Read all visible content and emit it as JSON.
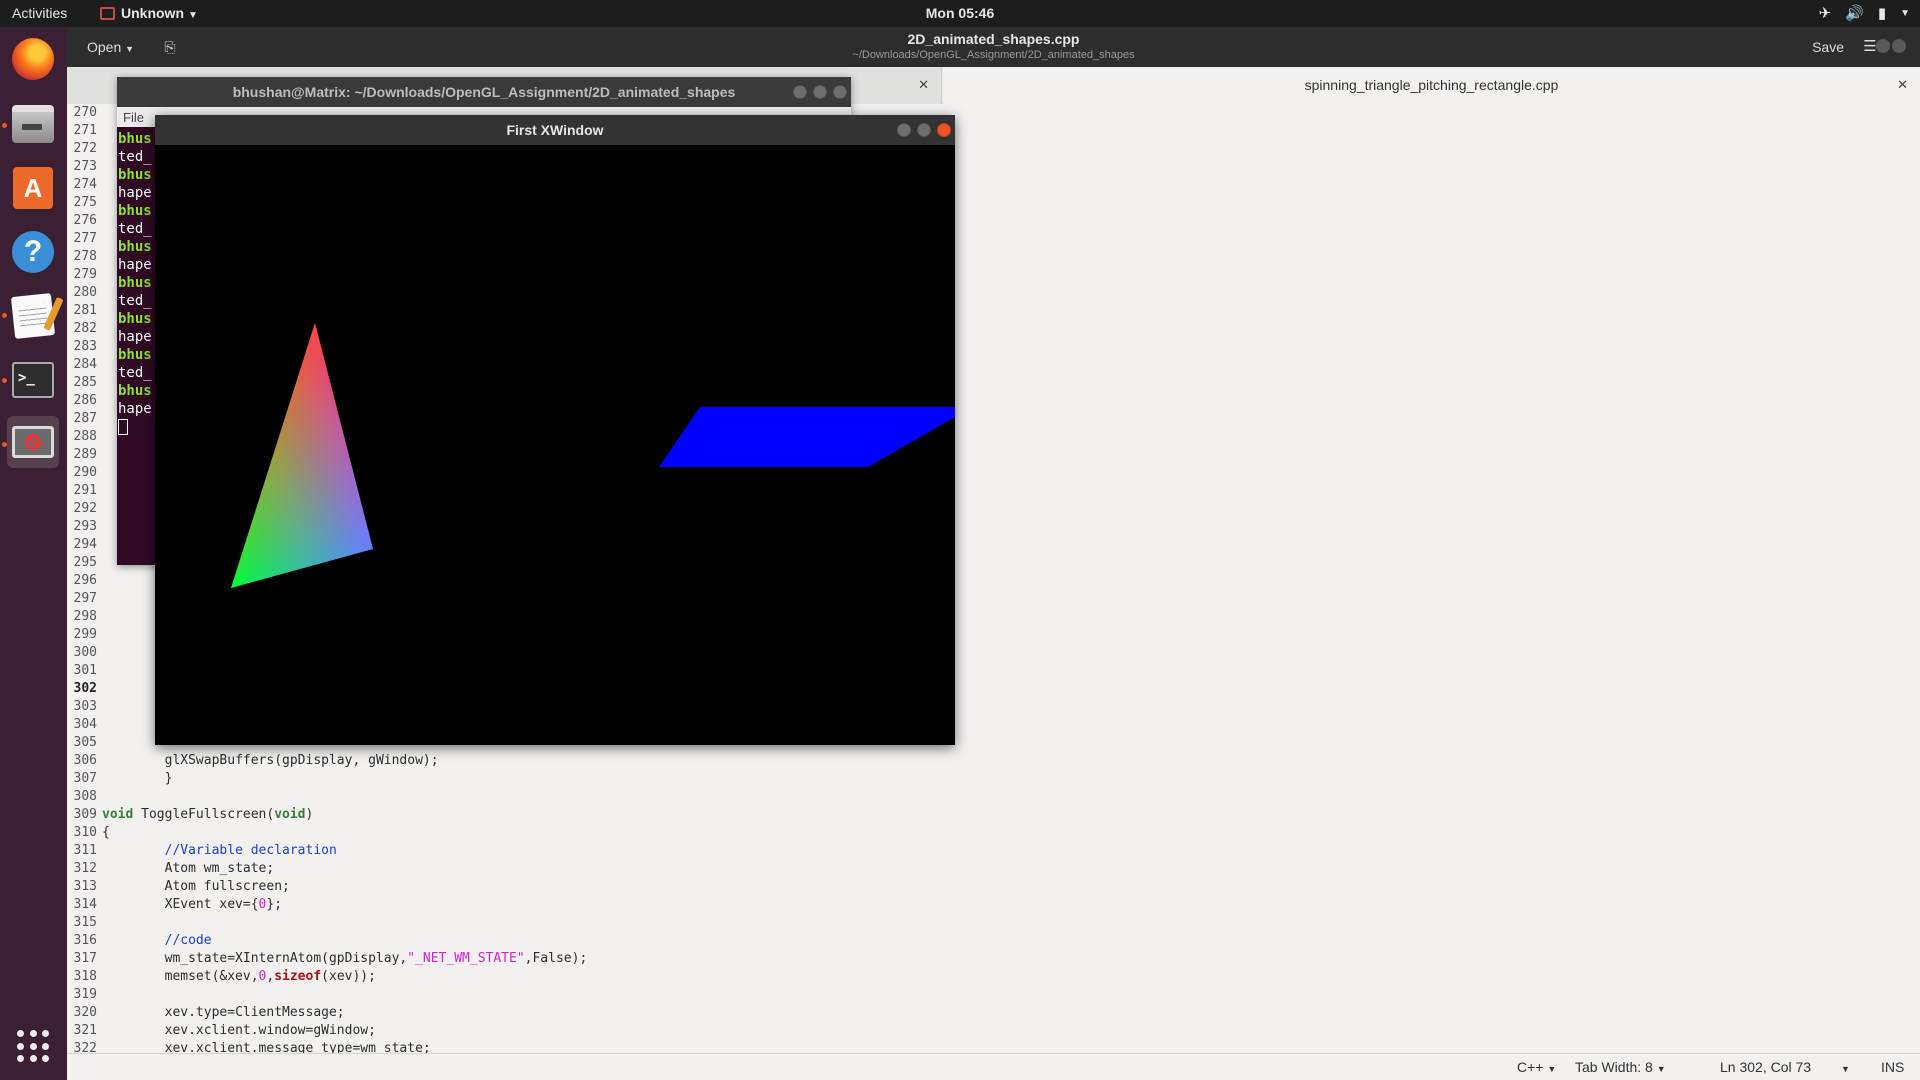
{
  "topbar": {
    "activities": "Activities",
    "app_name": "Unknown",
    "clock": "Mon 05:46",
    "tray_icons": [
      "airplane-mode-icon",
      "volume-icon",
      "battery-icon",
      "chevron-down-icon"
    ]
  },
  "dock": {
    "items": [
      "firefox",
      "files",
      "ubuntu-software",
      "help",
      "text-editor",
      "terminal",
      "blocked-app"
    ],
    "terminal_glyph": ">_",
    "software_glyph": "A",
    "help_glyph": "?"
  },
  "gedit": {
    "open_label": "Open",
    "title": "2D_animated_shapes.cpp",
    "path": "~/Downloads/OpenGL_Assignment/2D_animated_shapes",
    "save_label": "Save",
    "tabs": [
      {
        "label": "",
        "active": false
      },
      {
        "label": "spinning_triangle_pitching_rectangle.cpp",
        "active": true
      }
    ],
    "current_line": 302,
    "line_start": 270,
    "line_count": 53,
    "visible_code": {
      "306": "glXSwapBuffers(gpDisplay, gWindow);",
      "307": "}",
      "309": "void ToggleFullscreen(void)",
      "310": "{",
      "311": "//Variable declaration",
      "312": "Atom wm_state;",
      "313": "Atom fullscreen;",
      "314": "XEvent xev={0};",
      "316": "//code",
      "317": "wm_state=XInternAtom(gpDisplay,\"_NET_WM_STATE\",False);",
      "318": "memset(&xev,0,sizeof(xev));",
      "320": "xev.type=ClientMessage;",
      "321": "xev.xclient.window=gWindow;",
      "322": "xev.xclient.message_type=wm_state;"
    },
    "status": {
      "language": "C++",
      "tab_width": "Tab Width: 8",
      "position": "Ln 302, Col 73",
      "mode": "INS"
    }
  },
  "terminal": {
    "title": "bhushan@Matrix: ~/Downloads/OpenGL_Assignment/2D_animated_shapes",
    "menu_file": "File",
    "lines": [
      "bhus",
      "ted_",
      "bhus",
      "hape",
      "bhus",
      "ted_",
      "bhus",
      "hape",
      "bhus",
      "ted_",
      "bhus",
      "hape",
      "bhus",
      "ted_",
      "bhus",
      "hape"
    ]
  },
  "xwindow": {
    "title": "First XWindow",
    "background": "#000000",
    "triangle_colors": [
      "#ff0000",
      "#00ff00",
      "#0000ff"
    ],
    "rectangle_color": "#0000ff"
  }
}
